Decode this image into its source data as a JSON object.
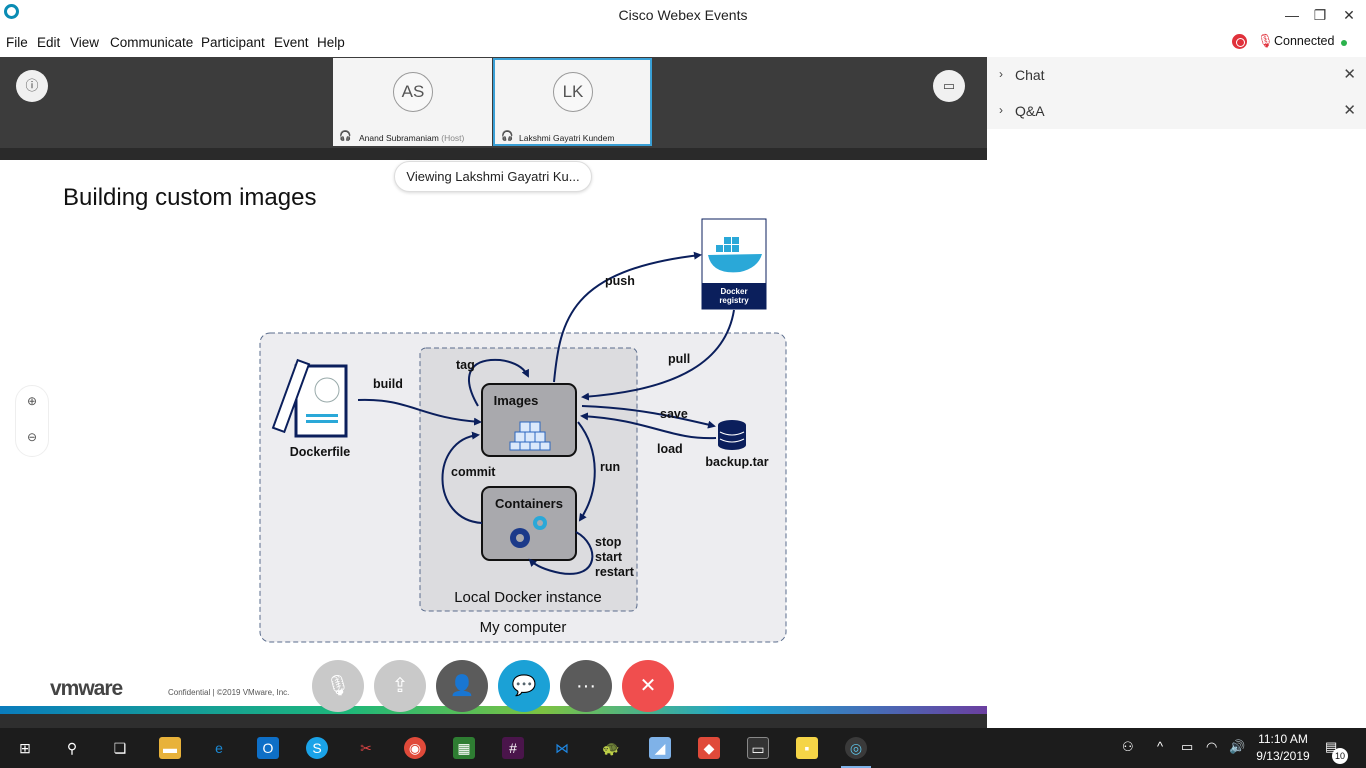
{
  "window": {
    "title": "Cisco Webex Events"
  },
  "menu": [
    "File",
    "Edit",
    "View",
    "Communicate",
    "Participant",
    "Event",
    "Help"
  ],
  "status": {
    "connected": "Connected"
  },
  "participants": [
    {
      "initials": "AS",
      "name": "Anand Subramaniam",
      "role": "(Host)"
    },
    {
      "initials": "LK",
      "name": "Lakshmi Gayatri Kundem",
      "role": ""
    }
  ],
  "panel": {
    "chat": "Chat",
    "qa": "Q&A"
  },
  "viewing": "Viewing Lakshmi Gayatri Ku...",
  "slide": {
    "title": "Building custom images",
    "diagram": {
      "my_computer": "My computer",
      "local_instance": "Local Docker instance",
      "dockerfile": "Dockerfile",
      "images": "Images",
      "containers": "Containers",
      "registry_l1": "Docker",
      "registry_l2": "registry",
      "backup": "backup.tar",
      "build": "build",
      "tag": "tag",
      "push": "push",
      "pull": "pull",
      "save": "save",
      "load": "load",
      "run": "run",
      "commit": "commit",
      "stop": "stop",
      "start": "start",
      "restart": "restart"
    },
    "vmware_logo": "vmware",
    "footer": "Confidential   |   ©2019 VMware, Inc."
  },
  "clock": {
    "time": "11:10 AM",
    "date": "9/13/2019"
  },
  "notification_count": "10",
  "icons": {
    "info": "info-icon",
    "layout": "layout-icon",
    "zoom_in": "zoom-in-icon",
    "zoom_out": "zoom-out-icon",
    "mute": "mic-icon",
    "share": "share-icon",
    "participants": "participants-icon",
    "chat": "chat-icon",
    "more": "more-icon",
    "leave": "close-icon"
  },
  "colors": {
    "chat_button": "#1ba1d6",
    "leave_button": "#f04e4e",
    "accent": "#0a8cb4",
    "diagram_navy": "#0b1f5c"
  }
}
